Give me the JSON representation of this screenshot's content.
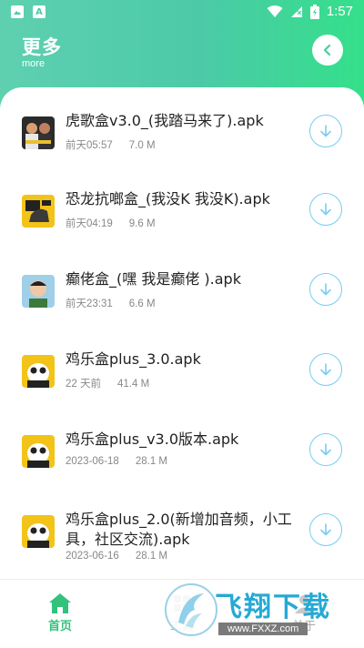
{
  "status_bar": {
    "time": "1:57",
    "left_icons": [
      "image-icon",
      "a-icon"
    ],
    "right_icons": [
      "wifi-icon",
      "signal-icon",
      "battery-icon"
    ]
  },
  "header": {
    "title": "更多",
    "subtitle": "more",
    "back_icon": "chevron-left-icon"
  },
  "files": [
    {
      "name": "虎歌盒v3.0_(我踏马来了).apk",
      "date": "前天05:57",
      "size": "7.0 M"
    },
    {
      "name": "恐龙抗啷盒_(我没K 我没K).apk",
      "date": "前天04:19",
      "size": "9.6 M"
    },
    {
      "name": "癫佬盒_(嘿 我是癫佬 ).apk",
      "date": "前天23:31",
      "size": "6.6 M"
    },
    {
      "name": "鸡乐盒plus_3.0.apk",
      "date": "22 天前",
      "size": "41.4 M"
    },
    {
      "name": "鸡乐盒plus_v3.0版本.apk",
      "date": "2023-06-18",
      "size": "28.1 M"
    },
    {
      "name": "鸡乐盒plus_2.0(新增加音频，小工具，社区交流).apk",
      "date": "2023-06-16",
      "size": "28.1 M"
    }
  ],
  "tabs": [
    {
      "label": "首页",
      "icon": "home-icon",
      "active": true
    },
    {
      "label": "工具",
      "icon": "tools-icon",
      "active": false
    },
    {
      "label": "关于",
      "icon": "about-icon",
      "active": false
    }
  ],
  "watermark": {
    "title": "飞翔下载",
    "url": "www.FXXZ.com"
  },
  "colors": {
    "accent": "#4ccaa8",
    "tab_active": "#32c27b",
    "download_ring": "#78cdf1"
  }
}
